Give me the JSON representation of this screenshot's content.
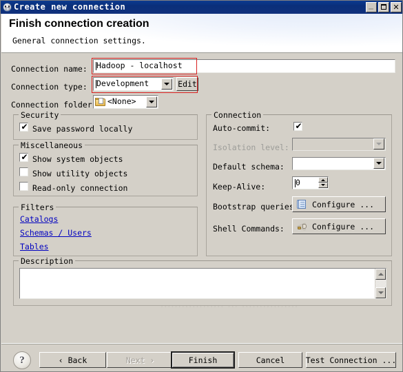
{
  "window": {
    "title": "Create new connection",
    "icon": "app-beaver-icon",
    "controls": {
      "minimize": "minimize",
      "maximize": "maximize",
      "close": "✕"
    }
  },
  "header": {
    "title": "Finish connection creation",
    "subtitle": "General connection settings."
  },
  "form": {
    "connection_name": {
      "label": "Connection name:",
      "value": "Hadoop - localhost"
    },
    "connection_type": {
      "label": "Connection type:",
      "value": "Development",
      "edit_button": "Edit"
    },
    "connection_folder": {
      "label": "Connection folder:",
      "value": "<None>"
    }
  },
  "security": {
    "title": "Security",
    "save_password": {
      "label": "Save password locally",
      "checked": true,
      "mark": "✔"
    }
  },
  "miscellaneous": {
    "title": "Miscellaneous",
    "items": [
      {
        "label": "Show system objects",
        "checked": true,
        "mark": "✔"
      },
      {
        "label": "Show utility objects",
        "checked": false,
        "mark": ""
      },
      {
        "label": "Read-only connection",
        "checked": false,
        "mark": ""
      }
    ]
  },
  "filters": {
    "title": "Filters",
    "links": [
      {
        "label": "Catalogs"
      },
      {
        "label": "Schemas / Users"
      },
      {
        "label": "Tables"
      }
    ]
  },
  "connection": {
    "title": "Connection",
    "auto_commit": {
      "label": "Auto-commit:",
      "checked": true,
      "mark": "✔"
    },
    "isolation_level": {
      "label": "Isolation level:",
      "value": "",
      "disabled": true
    },
    "default_schema": {
      "label": "Default schema:",
      "value": ""
    },
    "keep_alive": {
      "label": "Keep-Alive:",
      "value": "0"
    },
    "bootstrap_queries": {
      "label": "Bootstrap queries:",
      "button": "Configure ...",
      "icon": "scroll-icon"
    },
    "shell_commands": {
      "label": "Shell Commands:",
      "button": "Configure ...",
      "icon": "shell-icon"
    }
  },
  "description": {
    "title": "Description",
    "value": ""
  },
  "watermark": {
    "text": "·················· ··· ················"
  },
  "footer": {
    "help": "?",
    "buttons": [
      {
        "label": "‹ Back",
        "name": "back-button",
        "disabled": false,
        "default": false
      },
      {
        "label": "Next ›",
        "name": "next-button",
        "disabled": true,
        "default": false
      },
      {
        "label": "Finish",
        "name": "finish-button",
        "disabled": false,
        "default": true
      },
      {
        "label": "Cancel",
        "name": "cancel-button",
        "disabled": false,
        "default": false
      },
      {
        "label": "Test Connection ...",
        "name": "test-connection-button",
        "disabled": false,
        "default": false
      }
    ]
  },
  "colors": {
    "titlebar": "#0a2a74",
    "dialog_bg": "#d4d0c8",
    "link": "#0000c0",
    "annotation": "#d81f1f"
  }
}
